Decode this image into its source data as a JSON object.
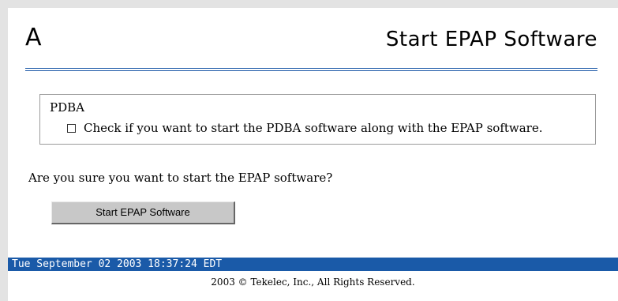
{
  "header": {
    "letter": "A",
    "title": "Start EPAP Software"
  },
  "pdba": {
    "legend": "PDBA",
    "checkbox_checked": false,
    "checkbox_label": "Check if you want to start the PDBA software along with the EPAP software."
  },
  "confirm": {
    "question": "Are you sure you want to start the EPAP software?",
    "button_label": "Start EPAP Software"
  },
  "status": {
    "datetime": "Tue September 02 2003 18:37:24 EDT"
  },
  "footer": {
    "copyright": "2003 © Tekelec, Inc., All Rights Reserved."
  },
  "colors": {
    "accent": "#1a5aa8",
    "button": "#c8c8c8"
  }
}
